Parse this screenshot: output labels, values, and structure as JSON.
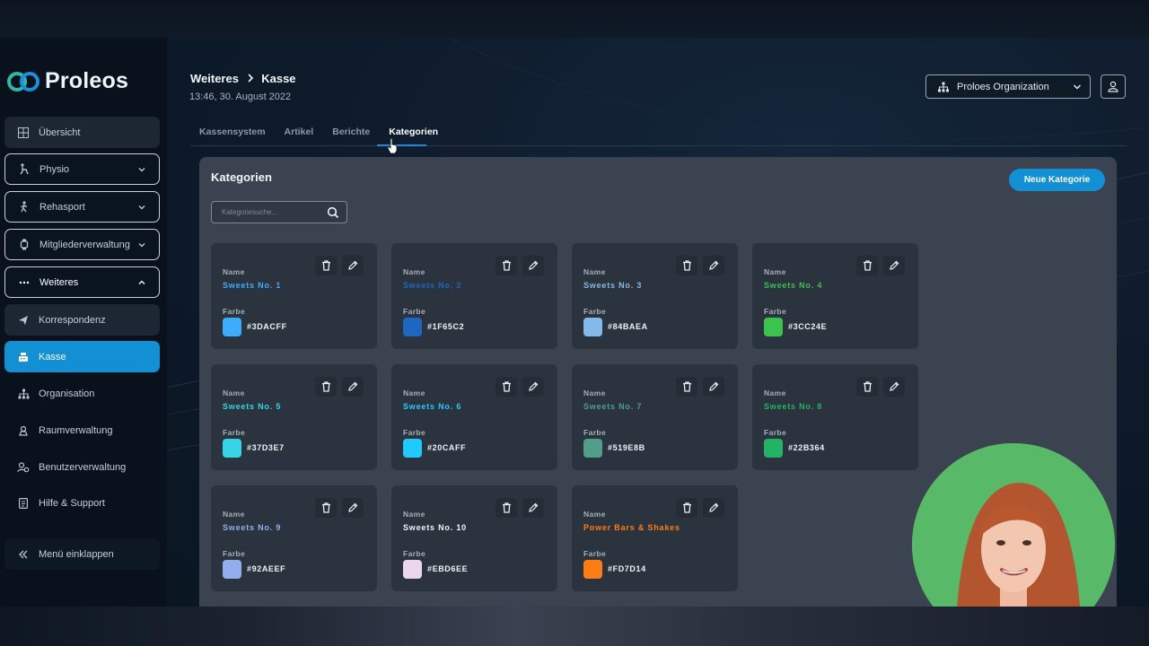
{
  "app": {
    "name": "Proleos"
  },
  "sidebar": {
    "items": [
      {
        "label": "Übersicht",
        "icon": "grid-icon"
      },
      {
        "label": "Physio",
        "icon": "physio-icon"
      },
      {
        "label": "Rehasport",
        "icon": "walking-icon"
      },
      {
        "label": "Mitgliederverwaltung",
        "icon": "watch-icon"
      },
      {
        "label": "Weiteres",
        "icon": "dots-icon"
      },
      {
        "label": "Korrespondenz",
        "icon": "send-icon"
      },
      {
        "label": "Kasse",
        "icon": "register-icon"
      },
      {
        "label": "Organisation",
        "icon": "sitemap-icon"
      },
      {
        "label": "Raumverwaltung",
        "icon": "room-icon"
      },
      {
        "label": "Benutzerverwaltung",
        "icon": "users-icon"
      },
      {
        "label": "Hilfe & Support",
        "icon": "help-icon"
      },
      {
        "label": "Menü einklappen",
        "icon": "collapse-icon"
      }
    ]
  },
  "header": {
    "breadcrumb": [
      "Weiteres",
      "Kasse"
    ],
    "datetime": "13:46, 30. August 2022",
    "organization": "Proloes Organization"
  },
  "tabs": [
    {
      "label": "Kassensystem",
      "active": false
    },
    {
      "label": "Artikel",
      "active": false
    },
    {
      "label": "Berichte",
      "active": false
    },
    {
      "label": "Kategorien",
      "active": true
    }
  ],
  "panel": {
    "title": "Kategorien",
    "new_button": "Neue Kategorie",
    "search_placeholder": "Kategoriesuche...",
    "name_label": "Name",
    "color_label": "Farbe"
  },
  "categories": [
    {
      "name": "Sweets No. 1",
      "color": "#3DACFF"
    },
    {
      "name": "Sweets No. 2",
      "color": "#1F65C2"
    },
    {
      "name": "Sweets No. 3",
      "color": "#84BAEA"
    },
    {
      "name": "Sweets No. 4",
      "color": "#3CC24E"
    },
    {
      "name": "Sweets No. 5",
      "color": "#37D3E7"
    },
    {
      "name": "Sweets No. 6",
      "color": "#20CAFF"
    },
    {
      "name": "Sweets No. 7",
      "color": "#519E8B"
    },
    {
      "name": "Sweets No. 8",
      "color": "#22B364"
    },
    {
      "name": "Sweets No. 9",
      "color": "#92AEEF"
    },
    {
      "name": "Sweets No. 10",
      "color": "#EBD6EE"
    },
    {
      "name": "Power Bars & Shakes",
      "color": "#FD7D14"
    }
  ]
}
